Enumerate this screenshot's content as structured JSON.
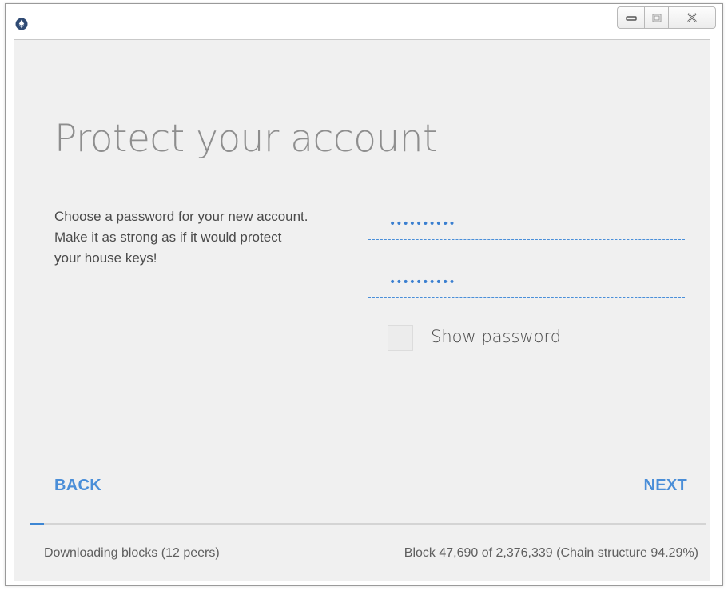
{
  "window": {
    "controls": {
      "minimize_icon": "minimize-icon",
      "maximize_icon": "maximize-icon",
      "close_icon": "close-icon"
    }
  },
  "page": {
    "title": "Protect your account",
    "description": "Choose a password for your new account. Make it as strong as if it would protect your house keys!"
  },
  "form": {
    "password": {
      "masked_value": "••••••••••"
    },
    "password_repeat": {
      "masked_value": "••••••••••"
    },
    "show_password": {
      "label": "Show password",
      "checked": false
    }
  },
  "navigation": {
    "back_label": "BACK",
    "next_label": "NEXT"
  },
  "status": {
    "sync_progress_fraction": 0.02,
    "downloading": "Downloading blocks (12 peers)",
    "block_info": "Block 47,690 of 2,376,339 (Chain structure 94.29%)"
  },
  "colors": {
    "accent": "#4a8ed8",
    "background": "#f0f0f0",
    "title_gray": "#8e8e8e"
  }
}
